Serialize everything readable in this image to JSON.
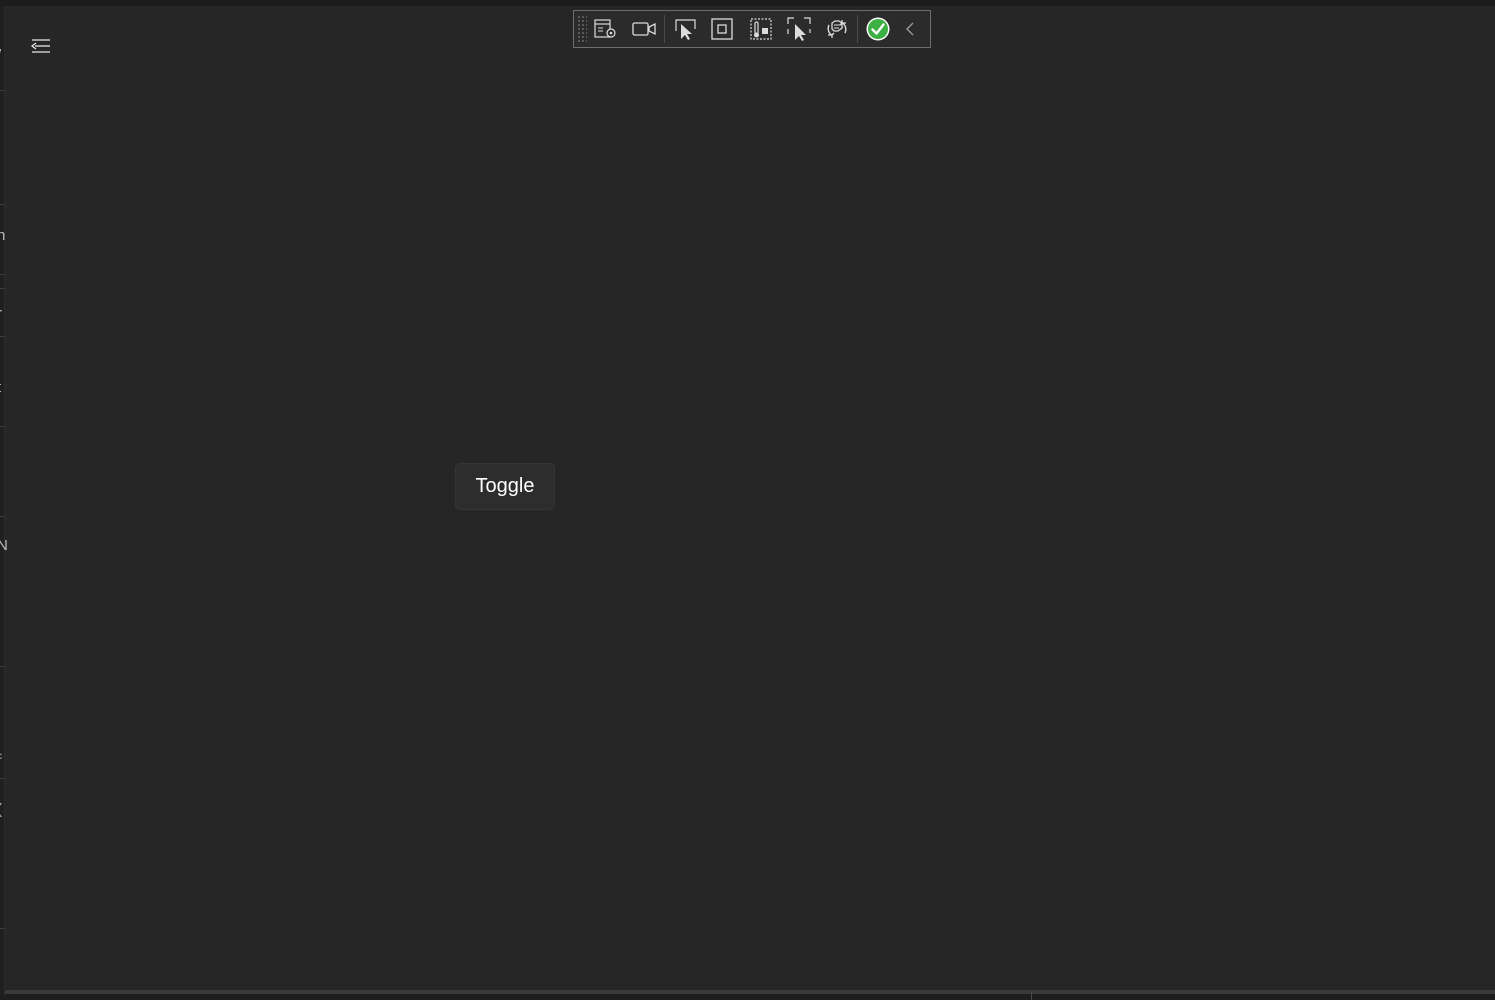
{
  "window": {
    "background": "#262626"
  },
  "left_edge_glyphs": [
    "/",
    "n",
    "r",
    "t",
    "r",
    "N",
    "c",
    "("
  ],
  "navigation": {
    "menu_icon": "hamburger-collapse-icon"
  },
  "dev_toolbar": {
    "buttons": [
      {
        "name": "go-to-live-visual-tree-icon"
      },
      {
        "name": "show-in-app-toolbar-video-icon"
      },
      {
        "name": "select-element-icon"
      },
      {
        "name": "display-layout-adorners-icon"
      },
      {
        "name": "track-focus-icon"
      },
      {
        "name": "binding-failures-icon"
      },
      {
        "name": "hot-reload-icon"
      },
      {
        "name": "status-ok-icon"
      },
      {
        "name": "collapse-chevron-icon"
      }
    ],
    "status_color": "#3cb043"
  },
  "main": {
    "toggle_label": "Toggle"
  }
}
